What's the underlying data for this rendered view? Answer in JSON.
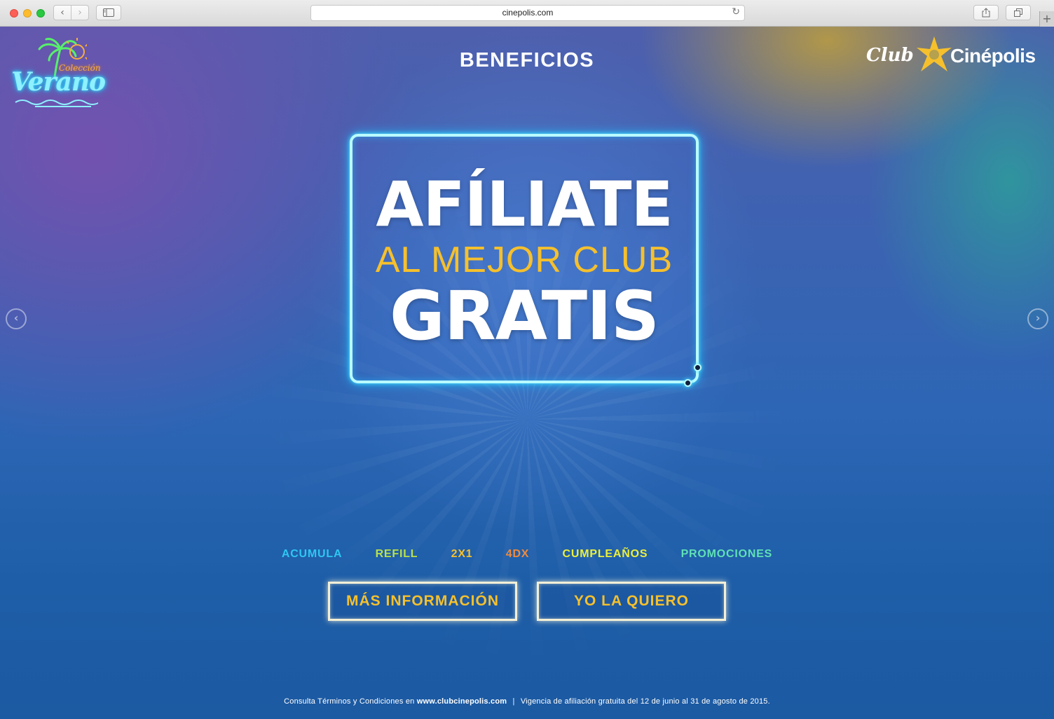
{
  "browser": {
    "url": "cinepolis.com",
    "back_icon": "‹",
    "forward_icon": "›",
    "reload_icon": "↻",
    "new_tab_icon": "+"
  },
  "header": {
    "section_title": "BENEFICIOS",
    "verano_logo": {
      "line1": "Colección",
      "line2": "Verano"
    },
    "club_logo": {
      "club": "Club",
      "brand": "Cinépolis"
    }
  },
  "hero": {
    "line1": "AFÍLIATE",
    "line2": "AL MEJOR CLUB",
    "line3": "GRATIS"
  },
  "carousel": {
    "prev_icon": "‹",
    "next_icon": "›"
  },
  "benefits_nav": [
    {
      "label": "ACUMULA",
      "color": "#2fc6f2"
    },
    {
      "label": "REFILL",
      "color": "#b9e14a"
    },
    {
      "label": "2X1",
      "color": "#f6c02c"
    },
    {
      "label": "4DX",
      "color": "#f08a3c"
    },
    {
      "label": "CUMPLEAÑOS",
      "color": "#ecef3a"
    },
    {
      "label": "PROMOCIONES",
      "color": "#5fe0b5"
    }
  ],
  "buttons": {
    "more_info": "MÁS INFORMACIÓN",
    "want_it": "YO LA QUIERO"
  },
  "footer": {
    "prefix": "Consulta Términos y Condiciones en",
    "site": "www.clubcinepolis.com",
    "separator": "|",
    "validity": "Vigencia de afiliación gratuita del 12 de junio al 31 de agosto de 2015."
  },
  "colors": {
    "accent_yellow": "#f6c02c",
    "neon_cyan": "#b9fbff"
  }
}
